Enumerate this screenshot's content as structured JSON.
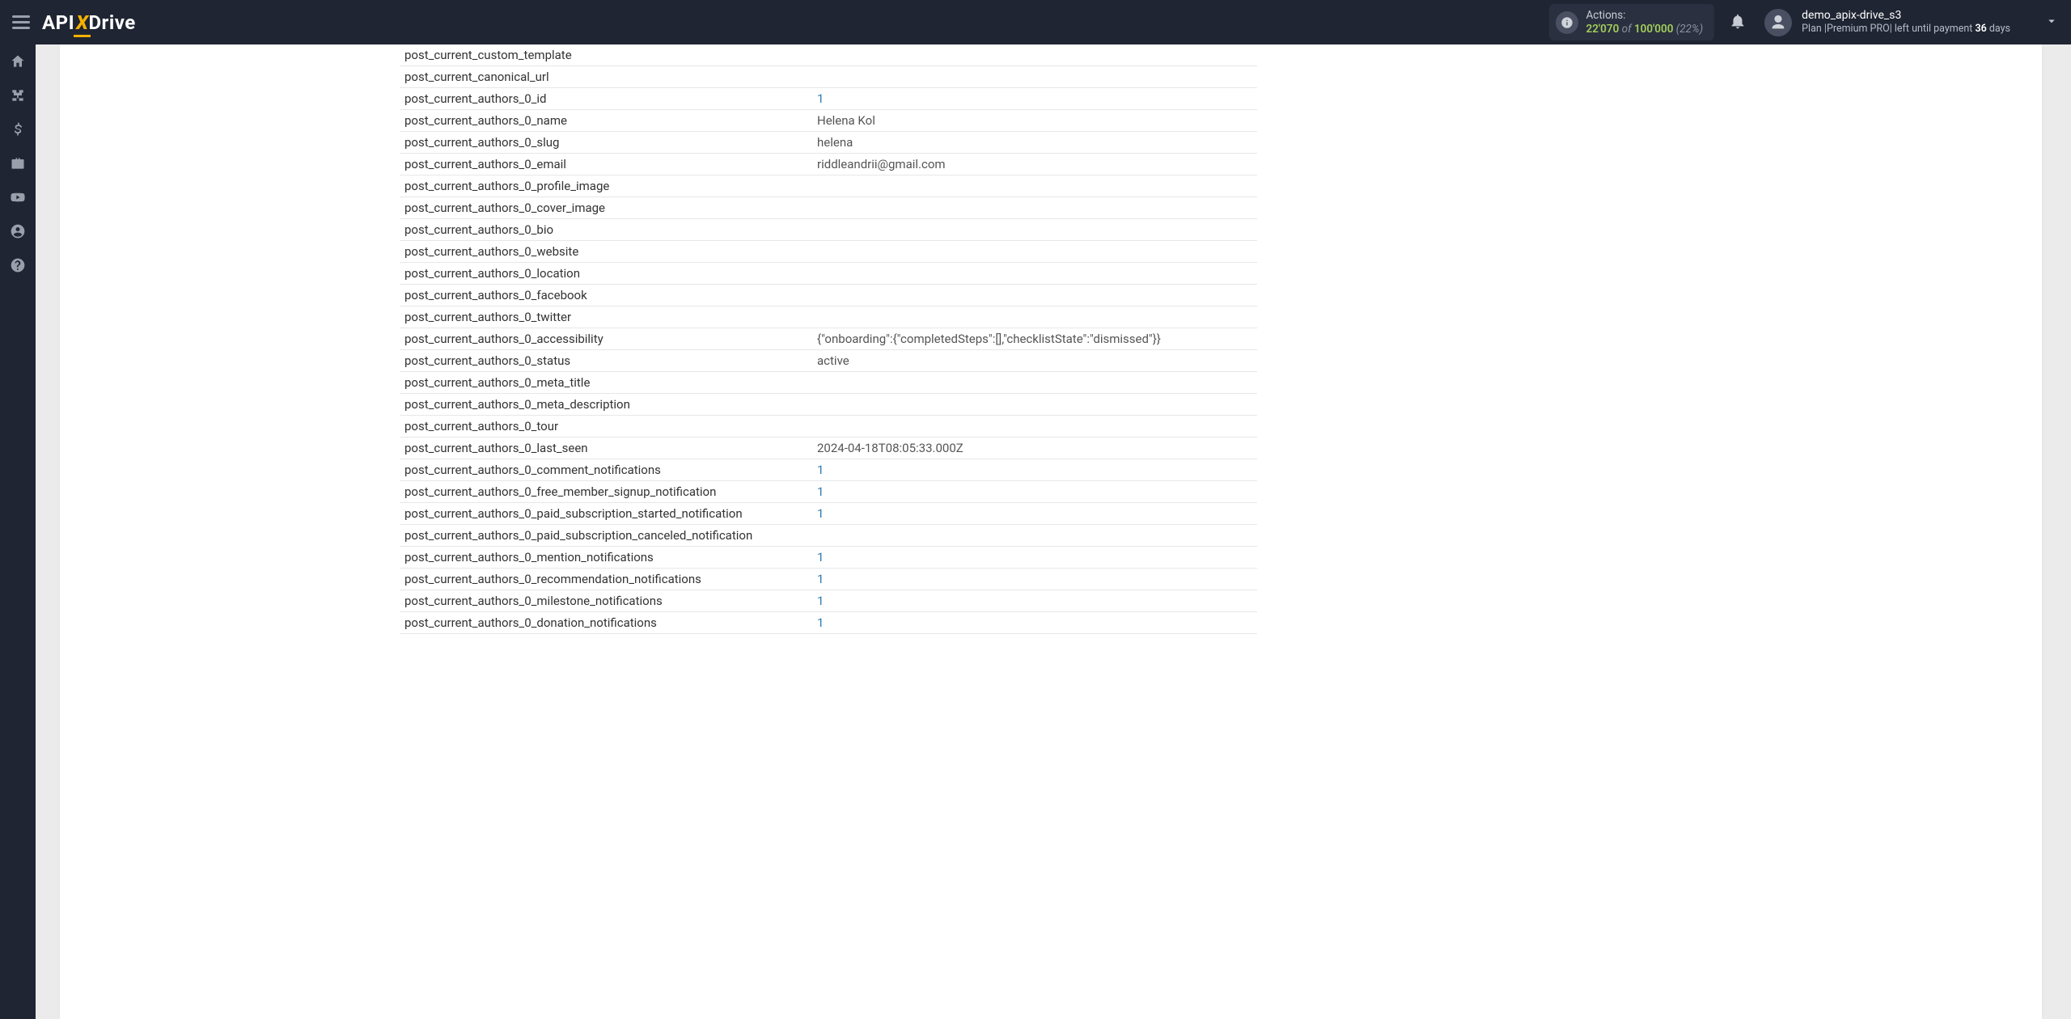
{
  "header": {
    "logo_api": "API",
    "logo_x": "X",
    "logo_drive": "Drive",
    "actions_label": "Actions:",
    "actions_current": "22'070",
    "actions_of": " of ",
    "actions_total": "100'000",
    "actions_percent": "(22%)",
    "username": "demo_apix-drive_s3",
    "plan_prefix": "Plan |",
    "plan_name": "Premium PRO",
    "plan_suffix": "| left until payment ",
    "plan_days": "36",
    "plan_days_unit": " days"
  },
  "rows": [
    {
      "k": "post_current_custom_template",
      "v": ""
    },
    {
      "k": "post_current_canonical_url",
      "v": ""
    },
    {
      "k": "post_current_authors_0_id",
      "v": "1",
      "num": true
    },
    {
      "k": "post_current_authors_0_name",
      "v": "Helena Kol"
    },
    {
      "k": "post_current_authors_0_slug",
      "v": "helena"
    },
    {
      "k": "post_current_authors_0_email",
      "v": "riddleandrii@gmail.com"
    },
    {
      "k": "post_current_authors_0_profile_image",
      "v": ""
    },
    {
      "k": "post_current_authors_0_cover_image",
      "v": ""
    },
    {
      "k": "post_current_authors_0_bio",
      "v": ""
    },
    {
      "k": "post_current_authors_0_website",
      "v": ""
    },
    {
      "k": "post_current_authors_0_location",
      "v": ""
    },
    {
      "k": "post_current_authors_0_facebook",
      "v": ""
    },
    {
      "k": "post_current_authors_0_twitter",
      "v": ""
    },
    {
      "k": "post_current_authors_0_accessibility",
      "v": "{\"onboarding\":{\"completedSteps\":[],\"checklistState\":\"dismissed\"}}"
    },
    {
      "k": "post_current_authors_0_status",
      "v": "active"
    },
    {
      "k": "post_current_authors_0_meta_title",
      "v": ""
    },
    {
      "k": "post_current_authors_0_meta_description",
      "v": ""
    },
    {
      "k": "post_current_authors_0_tour",
      "v": ""
    },
    {
      "k": "post_current_authors_0_last_seen",
      "v": "2024-04-18T08:05:33.000Z"
    },
    {
      "k": "post_current_authors_0_comment_notifications",
      "v": "1",
      "num": true
    },
    {
      "k": "post_current_authors_0_free_member_signup_notification",
      "v": "1",
      "num": true
    },
    {
      "k": "post_current_authors_0_paid_subscription_started_notification",
      "v": "1",
      "num": true
    },
    {
      "k": "post_current_authors_0_paid_subscription_canceled_notification",
      "v": ""
    },
    {
      "k": "post_current_authors_0_mention_notifications",
      "v": "1",
      "num": true
    },
    {
      "k": "post_current_authors_0_recommendation_notifications",
      "v": "1",
      "num": true
    },
    {
      "k": "post_current_authors_0_milestone_notifications",
      "v": "1",
      "num": true
    },
    {
      "k": "post_current_authors_0_donation_notifications",
      "v": "1",
      "num": true
    }
  ]
}
